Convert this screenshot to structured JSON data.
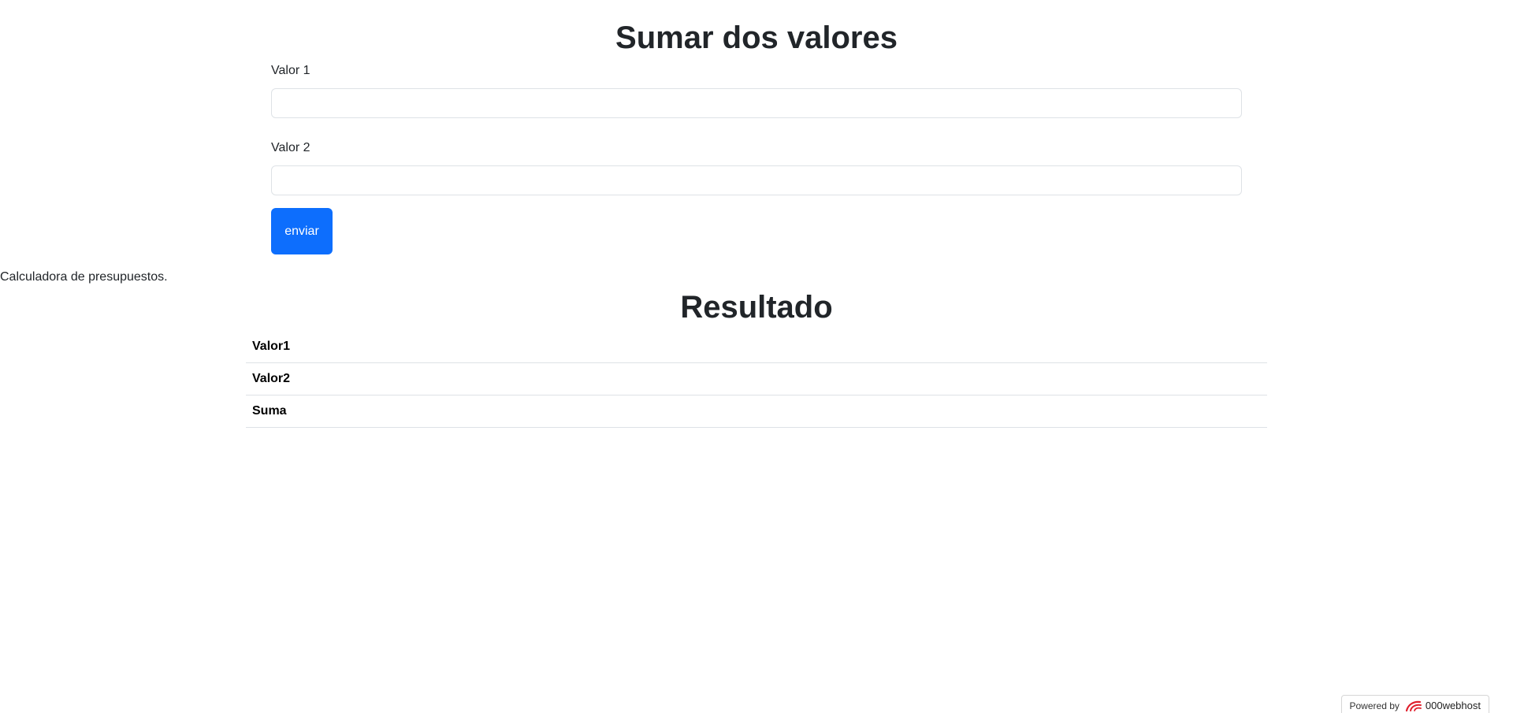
{
  "form": {
    "title": "Sumar dos valores",
    "field1": {
      "label": "Valor 1",
      "value": ""
    },
    "field2": {
      "label": "Valor 2",
      "value": ""
    },
    "submit_label": "enviar"
  },
  "tagline": "Calculadora de presupuestos.",
  "results": {
    "title": "Resultado",
    "rows": [
      {
        "label": "Valor1",
        "value": ""
      },
      {
        "label": "Valor2",
        "value": ""
      },
      {
        "label": "Suma",
        "value": ""
      }
    ]
  },
  "footer": {
    "powered_by": "Powered by",
    "brand": "000webhost",
    "brand_icon": "000webhost-logo-icon"
  },
  "colors": {
    "primary": "#0d6efd",
    "brand_icon": "#e0202d",
    "border": "#dee2e6",
    "text": "#212529"
  }
}
